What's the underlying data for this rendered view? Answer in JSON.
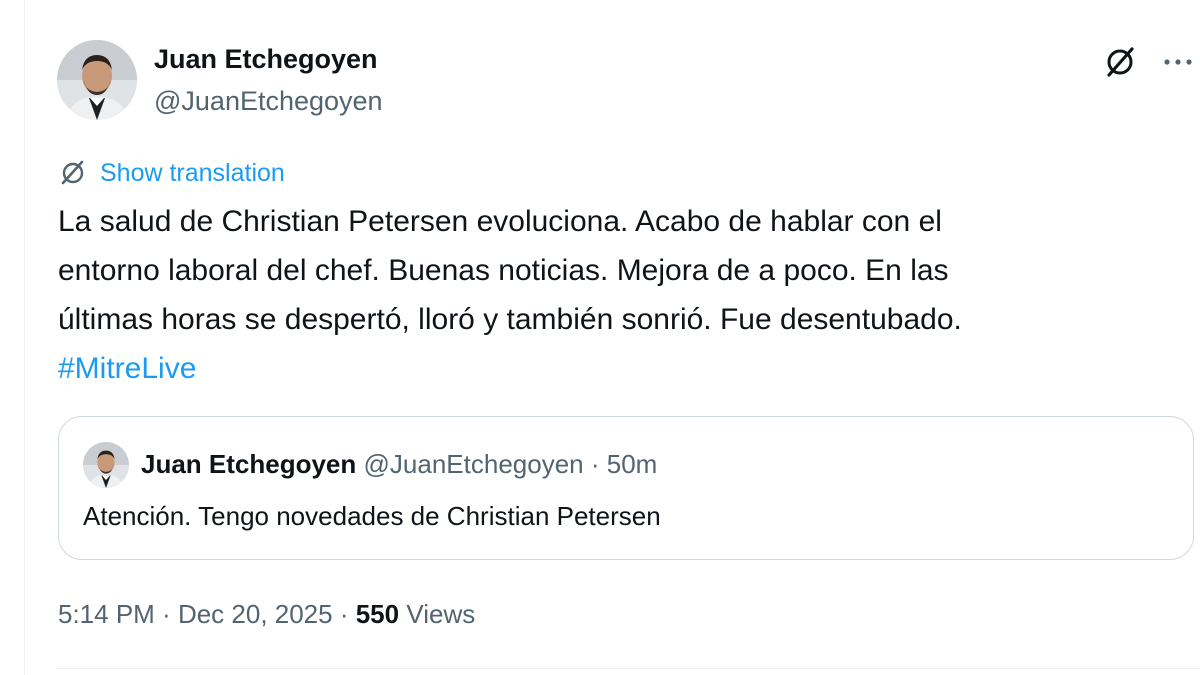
{
  "author": {
    "name": "Juan Etchegoyen",
    "handle": "@JuanEtchegoyen"
  },
  "actions": {
    "grok_icon": "grok-icon",
    "more_icon": "more-options-icon"
  },
  "translation": {
    "icon": "translate-icon",
    "label": "Show translation"
  },
  "tweet": {
    "lines": [
      "La salud de Christian Petersen evoluciona. Acabo de hablar con el",
      "entorno laboral del chef. Buenas noticias. Mejora de a poco. En las",
      "últimas horas se despertó, lloró y también sonrió. Fue desentubado."
    ],
    "hashtag": "#MitreLive"
  },
  "quoted_tweet": {
    "name": "Juan Etchegoyen",
    "handle": "@JuanEtchegoyen",
    "separator": " · ",
    "age": "50m",
    "text": "Atención. Tengo novedades de Christian Petersen"
  },
  "meta": {
    "time": "5:14 PM",
    "separator": " · ",
    "date": "Dec 20, 2025",
    "views_count": "550",
    "views_label": "Views"
  },
  "colors": {
    "accent": "#1d9bf0",
    "text": "#0f1419",
    "secondary": "#536471",
    "border": "#cfd9de"
  }
}
